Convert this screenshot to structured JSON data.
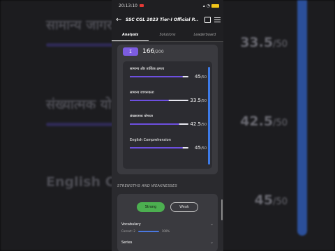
{
  "background": {
    "items": [
      {
        "label": "सामान्य जागर",
        "score": "33.5",
        "max": "/50"
      },
      {
        "label": "संख्यात्मक यो",
        "score": "42.5",
        "max": "/50"
      },
      {
        "label": "English Con",
        "score": "45",
        "max": "/50"
      }
    ]
  },
  "status_bar": {
    "time": "20:13:10",
    "battery": "100"
  },
  "app_bar": {
    "title": "SSC CGL 2023 Tier-I Official P..."
  },
  "tabs": [
    {
      "label": "Analysis",
      "active": true
    },
    {
      "label": "Solutions",
      "active": false
    },
    {
      "label": "Leaderboard",
      "active": false
    }
  ],
  "score_card": {
    "badge": "Σ",
    "total": "166",
    "total_max": "/200"
  },
  "subjects": [
    {
      "name": "सामान्य और तार्किक क्षमता",
      "score": "45",
      "max": "/50",
      "fraction": 0.9
    },
    {
      "name": "सामान्य जागरूकता",
      "score": "33.5",
      "max": "/50",
      "fraction": 0.67
    },
    {
      "name": "संख्यात्मक योग्यता",
      "score": "42.5",
      "max": "/50",
      "fraction": 0.85
    },
    {
      "name": "English Comprehension",
      "score": "45",
      "max": "/50",
      "fraction": 0.9
    }
  ],
  "strengths": {
    "section_title": "STRENGTHS AND WEAKNESSES",
    "strong_label": "Strong",
    "weak_label": "Weak",
    "topics": [
      {
        "name": "Vocabulary",
        "detail": "Correct: 2",
        "detail_right": "100%"
      },
      {
        "name": "Series",
        "detail": "",
        "detail_right": ""
      }
    ]
  },
  "colors": {
    "accent_purple": "#6d4fe0",
    "strong_green": "#4caf50",
    "scrollbar_blue": "#3d7be8"
  }
}
